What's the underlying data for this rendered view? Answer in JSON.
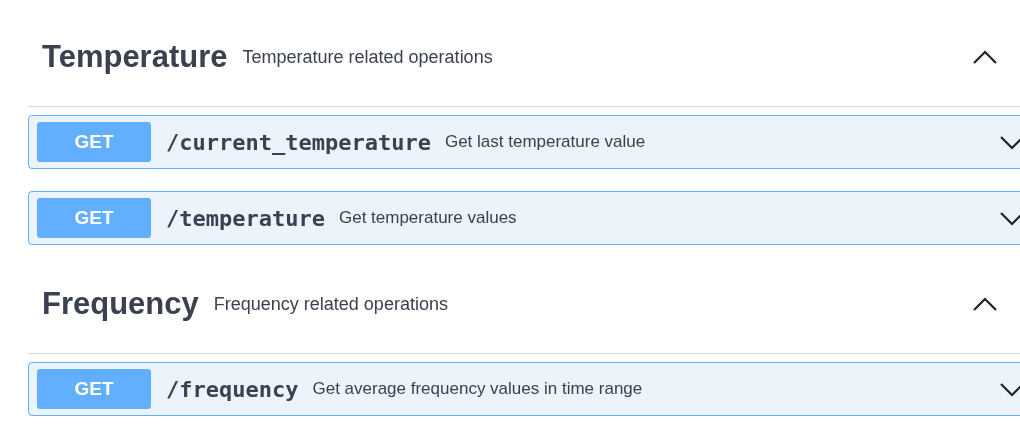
{
  "sections": [
    {
      "title": "Temperature",
      "description": "Temperature related operations",
      "expanded": true,
      "operations": [
        {
          "method": "GET",
          "path": "/current_temperature",
          "summary": "Get last temperature value",
          "expanded": false
        },
        {
          "method": "GET",
          "path": "/temperature",
          "summary": "Get temperature values",
          "expanded": false
        }
      ]
    },
    {
      "title": "Frequency",
      "description": "Frequency related operations",
      "expanded": true,
      "operations": [
        {
          "method": "GET",
          "path": "/frequency",
          "summary": "Get average frequency values in time range",
          "expanded": false
        }
      ]
    }
  ]
}
